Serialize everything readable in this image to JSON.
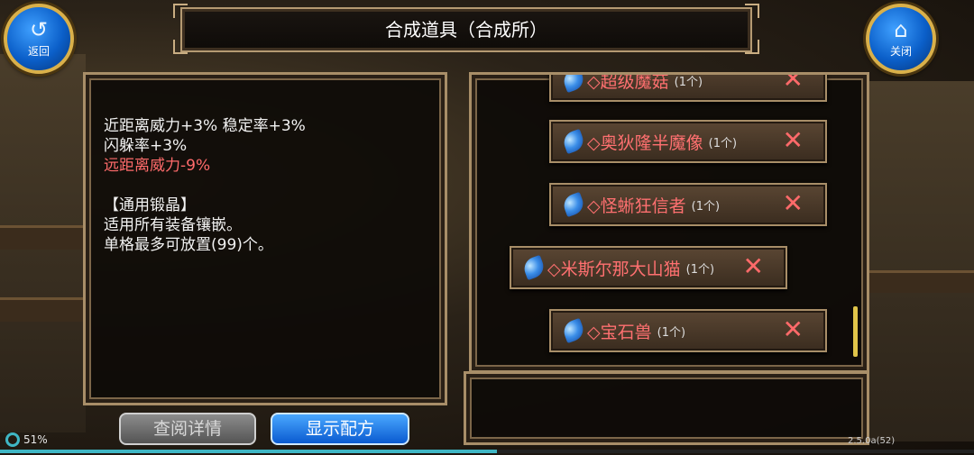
{
  "header": {
    "title": "合成道具（合成所）",
    "back_label": "返回",
    "close_label": "关闭"
  },
  "description": {
    "line1": "近距离威力+3% 稳定率+3%",
    "line2": "闪躲率+3%",
    "line3": "远距离威力-9%",
    "line5": "【通用锻晶】",
    "line6": "适用所有装备镶嵌。",
    "line7": "单格最多可放置(99)个。"
  },
  "items": [
    {
      "name": "◇超级魔菇",
      "count": "(1个)"
    },
    {
      "name": "◇奥狄隆半魔像",
      "count": "(1个)"
    },
    {
      "name": "◇怪蜥狂信者",
      "count": "(1个)"
    },
    {
      "name": "◇米斯尔那大山猫",
      "count": "(1个)"
    },
    {
      "name": "◇宝石兽",
      "count": "(1个)"
    }
  ],
  "buttons": {
    "details": "查阅详情",
    "show_recipe": "显示配方"
  },
  "status": {
    "battery": "51%",
    "battery_fraction": 0.51,
    "version": "2.5.0a(52)"
  },
  "colors": {
    "accent_blue": "#0b5fc9",
    "debuff_red": "#ff6b6b",
    "frame_gold": "#a88e68"
  },
  "icons": {
    "back": "undo-arrow-icon",
    "close": "home-icon",
    "item": "blue-crystal-icon",
    "remove": "close-x-icon"
  }
}
